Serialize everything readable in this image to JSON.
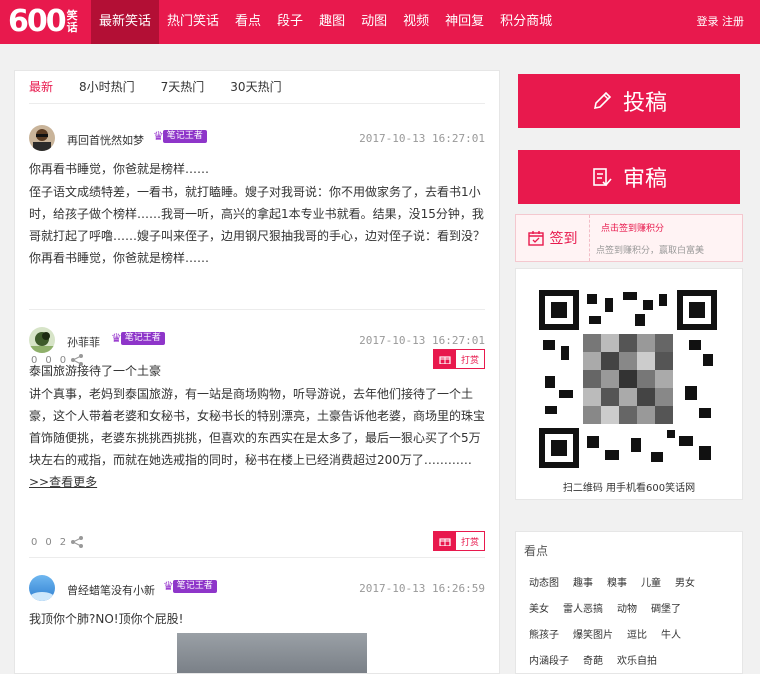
{
  "brand": {
    "logo_number": "600",
    "logo_sub_top": "笑",
    "logo_sub_bottom": "话",
    "accent": "#e8194d",
    "badge_color": "#8e35c9"
  },
  "nav": {
    "items": [
      "最新笑话",
      "热门笑话",
      "看点",
      "段子",
      "趣图",
      "动图",
      "视频",
      "神回复",
      "积分商城"
    ],
    "active_index": 0
  },
  "auth": {
    "login": "登录",
    "register": "注册"
  },
  "feed": {
    "tabs": [
      "最新",
      "8小时热门",
      "7天热门",
      "30天热门"
    ],
    "active_tab": 0,
    "posts": [
      {
        "author": "再回首恍然如梦",
        "badge": "笔记王者",
        "time": "2017-10-13 16:27:01",
        "title": "你再看书睡觉，你爸就是榜样……",
        "body": "侄子语文成绩特差，一看书，就打瞌睡。嫂子对我哥说：你不用做家务了，去看书1小时，给孩子做个榜样……我哥一听，高兴的拿起1本专业书就看。结果，没15分钟，我哥就打起了呼噜……嫂子叫来侄子，边用钢尺狠抽我哥的手心，边对侄子说：看到没？你再看书睡觉，你爸就是榜样……",
        "count_a": "0",
        "count_b": "0",
        "count_c": "0",
        "tip": "打赏"
      },
      {
        "author": "孙菲菲",
        "badge": "笔记王者",
        "time": "2017-10-13 16:27:01",
        "title": "泰国旅游接待了一个土豪",
        "body": "讲个真事，老妈到泰国旅游，有一站是商场购物，听导游说，去年他们接待了一个土豪，这个人带着老婆和女秘书，女秘书长的特别漂亮，土豪告诉他老婆，商场里的珠宝首饰随便挑，老婆东挑挑西挑挑，但喜欢的东西实在是太多了，最后一狠心买了个5万块左右的戒指，而就在她选戒指的同时，秘书在楼上已经消费超过200万了…………",
        "more": ">>查看更多",
        "count_a": "0",
        "count_b": "0",
        "count_c": "2",
        "tip": "打赏"
      },
      {
        "author": "曾经蜡笔没有小新",
        "badge": "笔记王者",
        "time": "2017-10-13 16:26:59",
        "title": "我顶你个肺?NO!顶你个屁股!"
      }
    ]
  },
  "sidebar": {
    "submit_label": "投稿",
    "review_label": "审稿",
    "checkin_label": "签到",
    "checkin_hint": "点击签到赚积分",
    "checkin_desc": "点签到赚积分，赢取白富美",
    "qr_caption": "扫二维码 用手机看600笑话网",
    "tags_title": "看点",
    "tags": [
      [
        "动态图",
        "趣事",
        "糗事",
        "儿童",
        "男女"
      ],
      [
        "美女",
        "雷人恶搞",
        "动物",
        "碉堡了"
      ],
      [
        "熊孩子",
        "爆笑图片",
        "逗比",
        "牛人"
      ],
      [
        "内涵段子",
        "奇葩",
        "欢乐自拍"
      ]
    ]
  }
}
